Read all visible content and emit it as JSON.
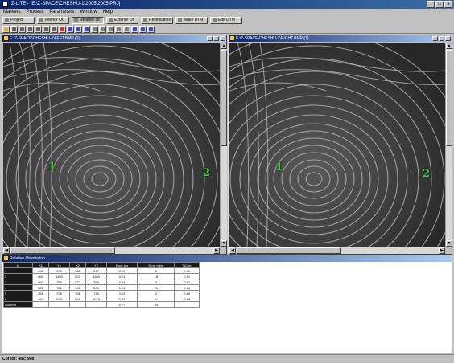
{
  "app": {
    "title": "Z-LITE - [E:\\Z-SPACE\\CHESHU-1\\2005\\2005.PRJ]",
    "window_buttons": [
      "_",
      "□",
      "x"
    ]
  },
  "menu": [
    "Markers",
    "Process",
    "Parameters",
    "Window",
    "Help"
  ],
  "modes": [
    {
      "label": "Project",
      "icon": "project-icon",
      "pressed": false
    },
    {
      "label": "Interior Or.",
      "icon": "interior-orientation-icon",
      "pressed": false
    },
    {
      "label": "Relative Or.",
      "icon": "relative-orientation-icon",
      "pressed": true
    },
    {
      "label": "Exterior Or.",
      "icon": "exterior-orientation-icon",
      "pressed": false
    },
    {
      "label": "Rectification",
      "icon": "rectification-icon",
      "pressed": false
    },
    {
      "label": "Make DTM",
      "icon": "make-dtm-icon",
      "pressed": false
    },
    {
      "label": "Edit DTM",
      "icon": "edit-dtm-icon",
      "pressed": false
    }
  ],
  "tools": [
    {
      "name": "open-icon",
      "color": "#e0b040"
    },
    {
      "name": "zoom-in-icon",
      "color": "#606060"
    },
    {
      "name": "zoom-out-icon",
      "color": "#606060"
    },
    {
      "name": "zoom-fit-icon",
      "color": "#606060"
    },
    {
      "name": "zoom-window-icon",
      "color": "#606060"
    },
    {
      "name": "magnify-icon",
      "color": "#606060"
    },
    {
      "name": "pan-icon",
      "color": "#606060"
    },
    {
      "name": "marker-icon",
      "color": "#d03030"
    },
    {
      "name": "contrast-icon",
      "color": "#3050c0"
    },
    {
      "name": "brightness-icon",
      "color": "#3050c0"
    },
    {
      "name": "gamma-icon",
      "color": "#3050c0"
    },
    {
      "name": "filter-icon",
      "color": "#808080"
    },
    {
      "name": "measure-icon",
      "color": "#808080"
    },
    {
      "name": "link-icon",
      "color": "#808080"
    },
    {
      "name": "grid-icon",
      "color": "#808080"
    },
    {
      "name": "settings-icon",
      "color": "#808080"
    },
    {
      "name": "save-icon",
      "color": "#3050c0"
    },
    {
      "name": "table-icon",
      "color": "#3050c0"
    },
    {
      "name": "help-icon",
      "color": "#3050c0"
    }
  ],
  "images": {
    "left": {
      "title": "E:\\Z-SPACE\\CHESHU-1\\LEFT.BMP (1)",
      "markers": [
        {
          "label": "1"
        },
        {
          "label": "2"
        }
      ]
    },
    "right": {
      "title": "E:\\Z-SPACE\\CHESHU-1\\RIGHT.BMP (1)",
      "markers": [
        {
          "label": "1"
        },
        {
          "label": "2"
        }
      ]
    }
  },
  "relative": {
    "title": "Relative Orientation",
    "headers": [
      "N",
      "X1",
      "Y1",
      "X2",
      "Y2",
      "Error pix",
      "Error mkm",
      "%Corr"
    ],
    "rows": [
      {
        "label": "1",
        "cells": [
          "296",
          "279",
          "368",
          "277",
          "0.09",
          "8",
          "0.91"
        ]
      },
      {
        "label": "2",
        "cells": [
          "650",
          "1160",
          "523",
          "1160",
          "0.21",
          "18",
          "0.91"
        ]
      },
      {
        "label": "3",
        "cells": [
          "663",
          "258",
          "577",
          "256",
          "0.04",
          "3",
          "0.91"
        ]
      },
      {
        "label": "4",
        "cells": [
          "321",
          "781",
          "300",
          "909",
          "0.24",
          "20",
          "0.96"
        ]
      },
      {
        "label": "5",
        "cells": [
          "256",
          "735",
          "751",
          "733",
          "0.03",
          "2",
          "0.89"
        ]
      },
      {
        "label": "6",
        "cells": [
          "460",
          "1031",
          "456",
          "1019",
          "0.37",
          "31",
          "0.88"
        ]
      }
    ],
    "footer": {
      "label": "Summa",
      "cells": [
        "",
        "",
        "",
        "",
        "0.77",
        "64",
        ""
      ]
    }
  },
  "status": {
    "text": "Cursor: 482; 908"
  }
}
